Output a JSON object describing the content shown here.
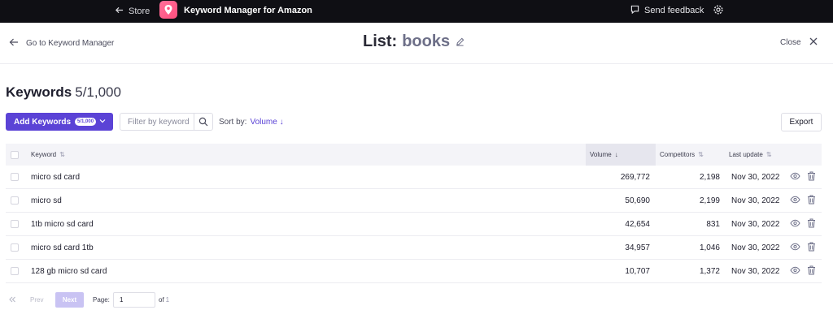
{
  "topbar": {
    "store_label": "Store",
    "app_title": "Keyword Manager for Amazon",
    "feedback_label": "Send feedback"
  },
  "header": {
    "back_label": "Go to Keyword Manager",
    "list_prefix": "List:",
    "list_name": "books",
    "close_label": "Close"
  },
  "keywords": {
    "title": "Keywords",
    "count": "5/1,000"
  },
  "toolbar": {
    "add_label": "Add Keywords",
    "add_badge": "5/1,000",
    "filter_placeholder": "Filter by keyword",
    "sort_label": "Sort by:",
    "sort_value": "Volume ↓",
    "export_label": "Export"
  },
  "table": {
    "headers": {
      "keyword": "Keyword",
      "volume": "Volume",
      "competitors": "Competitors",
      "last_update": "Last update"
    },
    "rows": [
      {
        "keyword": "micro sd card",
        "volume": "269,772",
        "competitors": "2,198",
        "last_update": "Nov 30, 2022"
      },
      {
        "keyword": "micro sd",
        "volume": "50,690",
        "competitors": "2,199",
        "last_update": "Nov 30, 2022"
      },
      {
        "keyword": "1tb micro sd card",
        "volume": "42,654",
        "competitors": "831",
        "last_update": "Nov 30, 2022"
      },
      {
        "keyword": "micro sd card 1tb",
        "volume": "34,957",
        "competitors": "1,046",
        "last_update": "Nov 30, 2022"
      },
      {
        "keyword": "128 gb micro sd card",
        "volume": "10,707",
        "competitors": "1,372",
        "last_update": "Nov 30, 2022"
      }
    ]
  },
  "pagination": {
    "prev_label": "Prev",
    "next_label": "Next",
    "page_label": "Page:",
    "page_value": "1",
    "of_label": "of",
    "total_pages": "1"
  },
  "colors": {
    "accent": "#5b43d6",
    "topbar": "#0f0f14",
    "logo": "#ff4f7e"
  },
  "icons": [
    "arrow-left-icon",
    "app-logo-icon",
    "feedback-icon",
    "gear-icon",
    "edit-pencil-icon",
    "close-icon",
    "chevron-down-icon",
    "search-icon",
    "sort-icon",
    "eye-icon",
    "trash-icon",
    "double-chevron-left-icon"
  ]
}
